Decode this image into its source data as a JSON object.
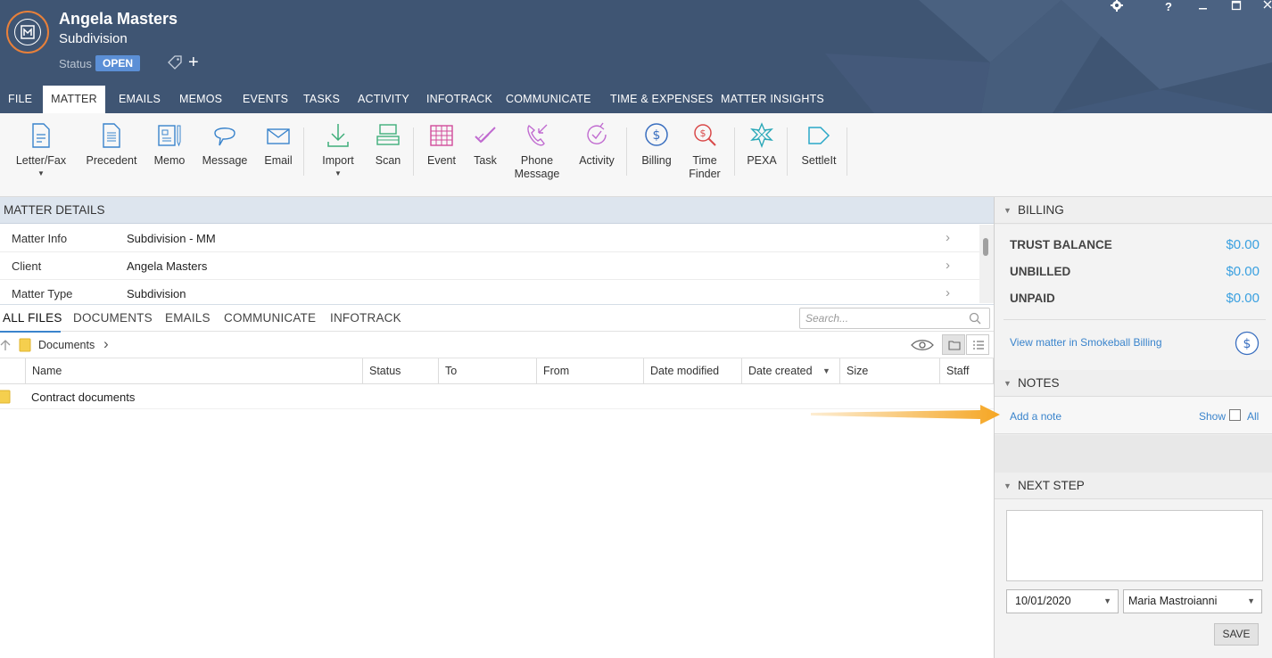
{
  "header": {
    "client_name": "Angela Masters",
    "matter_name": "Subdivision",
    "status_label": "Status",
    "status_value": "OPEN",
    "window_controls": [
      "settings",
      "help",
      "minimize",
      "maximize",
      "close"
    ]
  },
  "tabs": [
    "FILE",
    "MATTER",
    "EMAILS",
    "MEMOS",
    "EVENTS",
    "TASKS",
    "ACTIVITY",
    "INFOTRACK",
    "COMMUNICATE",
    "TIME & EXPENSES",
    "MATTER INSIGHTS"
  ],
  "active_tab": "MATTER",
  "ribbon": {
    "letter_fax": "Letter/Fax",
    "precedent": "Precedent",
    "memo": "Memo",
    "message": "Message",
    "email": "Email",
    "import": "Import",
    "scan": "Scan",
    "event": "Event",
    "task": "Task",
    "phone_message_1": "Phone",
    "phone_message_2": "Message",
    "activity": "Activity",
    "billing": "Billing",
    "time_finder_1": "Time",
    "time_finder_2": "Finder",
    "pexa": "PEXA",
    "settleit": "SettleIt"
  },
  "matter_details": {
    "title": "MATTER DETAILS",
    "rows": [
      {
        "label": "Matter Info",
        "value": "Subdivision - MM"
      },
      {
        "label": "Client",
        "value": "Angela Masters"
      },
      {
        "label": "Matter Type",
        "value": "Subdivision"
      }
    ]
  },
  "files": {
    "tabs": [
      "ALL FILES",
      "DOCUMENTS",
      "EMAILS",
      "COMMUNICATE",
      "INFOTRACK"
    ],
    "search_placeholder": "Search...",
    "breadcrumb": "Documents",
    "columns": [
      "Name",
      "Status",
      "To",
      "From",
      "Date modified",
      "Date created",
      "Size",
      "Staff"
    ],
    "rows": [
      {
        "name": "Contract documents"
      }
    ]
  },
  "billing": {
    "title": "BILLING",
    "trust_label": "TRUST BALANCE",
    "trust_value": "$0.00",
    "unbilled_label": "UNBILLED",
    "unbilled_value": "$0.00",
    "unpaid_label": "UNPAID",
    "unpaid_value": "$0.00",
    "view_link": "View matter in Smokeball Billing"
  },
  "notes": {
    "title": "NOTES",
    "add_note": "Add a note",
    "show_label": "Show",
    "all_label": "All"
  },
  "next_step": {
    "title": "NEXT STEP",
    "date": "10/01/2020",
    "staff": "Maria Mastroianni",
    "save_label": "SAVE"
  },
  "colors": {
    "header_bg": "#3f5573",
    "accent_orange": "#e8803a",
    "status_blue": "#5b8fd6",
    "link_blue": "#3a84cc",
    "money_blue": "#3aa0e0",
    "arrow_yellow": "#f5a623"
  }
}
